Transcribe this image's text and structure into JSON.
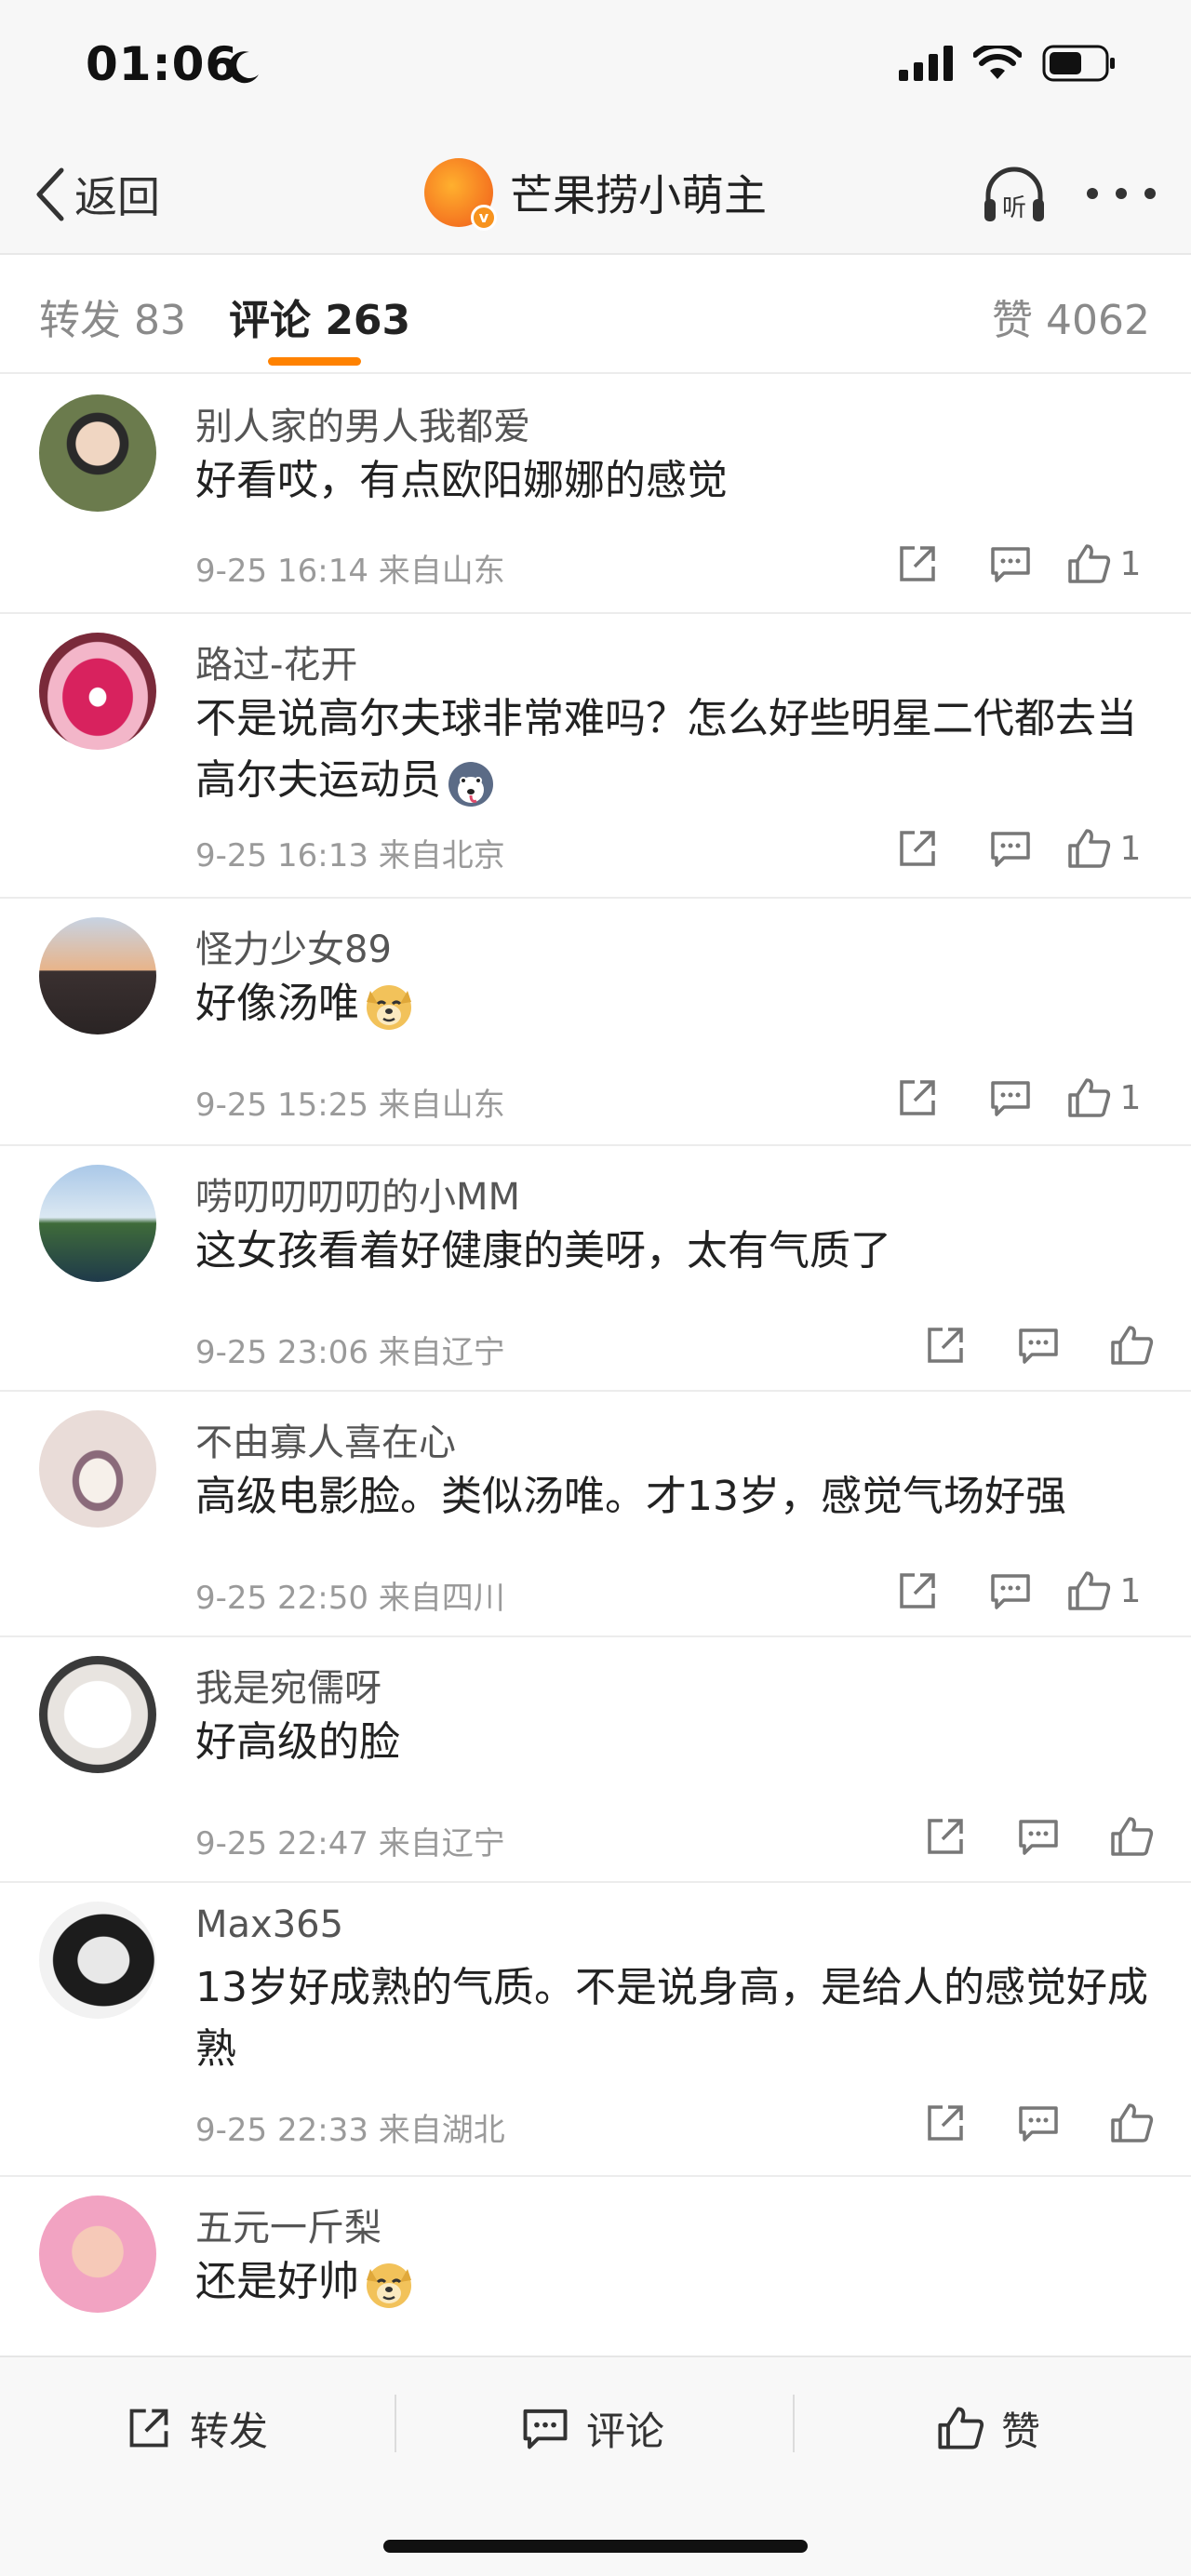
{
  "status_bar": {
    "time": "01:06"
  },
  "nav": {
    "back_label": "返回",
    "title": "芒果捞小萌主",
    "avatar_badge": "v",
    "listen_label": "听"
  },
  "tabs": {
    "repost": "转发 83",
    "comments": "评论 263",
    "likes": "赞 4062"
  },
  "comments": [
    {
      "user": "别人家的男人我都爱",
      "text": "好看哎，有点欧阳娜娜的感觉",
      "meta": "9-25 16:14  来自山东",
      "likes": "1"
    },
    {
      "user": "路过-花开",
      "text": "不是说高尔夫球非常难吗？怎么好些明星二代都去当高尔夫运动员",
      "meta": "9-25 16:13  来自北京",
      "likes": "1",
      "emoji": "husky-emoji"
    },
    {
      "user": "怪力少女89",
      "text": "好像汤唯",
      "meta": "9-25 15:25  来自山东",
      "likes": "1",
      "emoji": "doge-emoji"
    },
    {
      "user": "唠叨叨叨叨的小MM",
      "text": "这女孩看着好健康的美呀，太有气质了",
      "meta": "9-25 23:06  来自辽宁",
      "likes": ""
    },
    {
      "user": "不由寡人喜在心",
      "text": "高级电影脸。类似汤唯。才13岁，感觉气场好强",
      "meta": "9-25 22:50  来自四川",
      "likes": "1"
    },
    {
      "user": "我是宛儒呀",
      "text": "好高级的脸",
      "meta": "9-25 22:47  来自辽宁",
      "likes": ""
    },
    {
      "user": "Max365",
      "text": "13岁好成熟的气质。不是说身高，是给人的感觉好成熟",
      "meta": "9-25 22:33  来自湖北",
      "likes": ""
    },
    {
      "user": "五元一斤梨",
      "text": "还是好帅",
      "meta": "",
      "likes": "",
      "emoji": "doge-emoji"
    }
  ],
  "bottom_bar": {
    "repost": "转发",
    "comment": "评论",
    "like": "赞"
  },
  "colors": {
    "accent": "#ff8200",
    "muted": "#9a9a9a"
  }
}
